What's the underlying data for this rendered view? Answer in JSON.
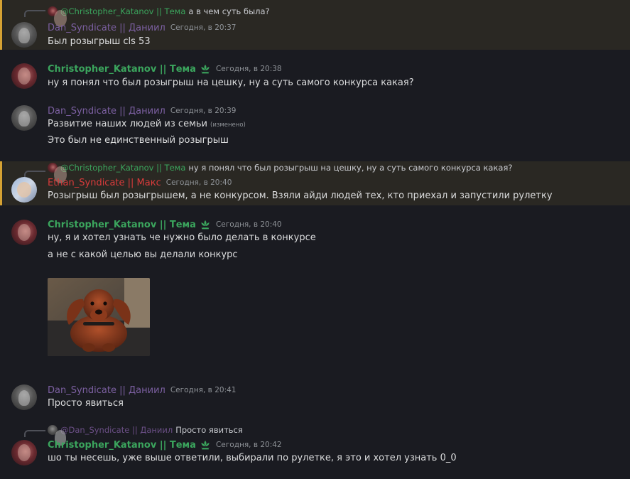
{
  "messages": [
    {
      "reply_to": {
        "author": "@Christopher_Katanov || Тема",
        "text": "а в чем суть была?"
      },
      "author": "Dan_Syndicate || Даниил",
      "time": "Сегодня, в 20:37",
      "lines": [
        "Был розыгрыш cls 53"
      ],
      "highlighted": true
    },
    {
      "author": "Christopher_Katanov || Тема",
      "time": "Сегодня, в 20:38",
      "lines": [
        "ну я понял что был розыгрыш на цешку, ну а суть самого конкурса какая?"
      ]
    },
    {
      "author": "Dan_Syndicate || Даниил",
      "time": "Сегодня, в 20:39",
      "lines": [
        "Развитие наших людей из семьи",
        "Это был не единственный розыгрыш"
      ],
      "edited_label": "(изменено)"
    },
    {
      "reply_to": {
        "author": "@Christopher_Katanov || Тема",
        "text": "ну я понял что был розыгрыш на цешку, ну а суть самого конкурса какая?"
      },
      "author": "Ethan_Syndicate || Макс",
      "time": "Сегодня, в 20:40",
      "lines": [
        "Розыгрыш был розыгрышем, а не конкурсом. Взяли айди людей тех, кто приехал и запустили рулетку"
      ],
      "highlighted": true
    },
    {
      "author": "Christopher_Katanov || Тема",
      "time": "Сегодня, в 20:40",
      "lines": [
        "ну, я и хотел узнать че нужно было делать в конкурсе",
        "а не с какой целью вы делали конкурс"
      ],
      "attachment": "dachshund-photo"
    },
    {
      "author": "Dan_Syndicate || Даниил",
      "time": "Сегодня, в 20:41",
      "lines": [
        "Просто явиться"
      ]
    },
    {
      "reply_to": {
        "author": "@Dan_Syndicate || Даниил",
        "text": "Просто явиться"
      },
      "author": "Christopher_Katanov || Тема",
      "time": "Сегодня, в 20:42",
      "lines": [
        "шо ты несешь, уже выше ответили, выбирали по рулетке, я это и хотел узнать 0_0"
      ]
    }
  ],
  "colors": {
    "background": "#1a1b21",
    "highlight_bg": "#2a2823",
    "highlight_bar": "#d6a233",
    "dan_name": "#7b5fa0",
    "chris_name": "#3ba55d",
    "ethan_name": "#d93b3b",
    "text": "#dcddde",
    "timestamp": "#8e9297"
  },
  "icons": {
    "role_icon": "lotus-badge-icon"
  }
}
